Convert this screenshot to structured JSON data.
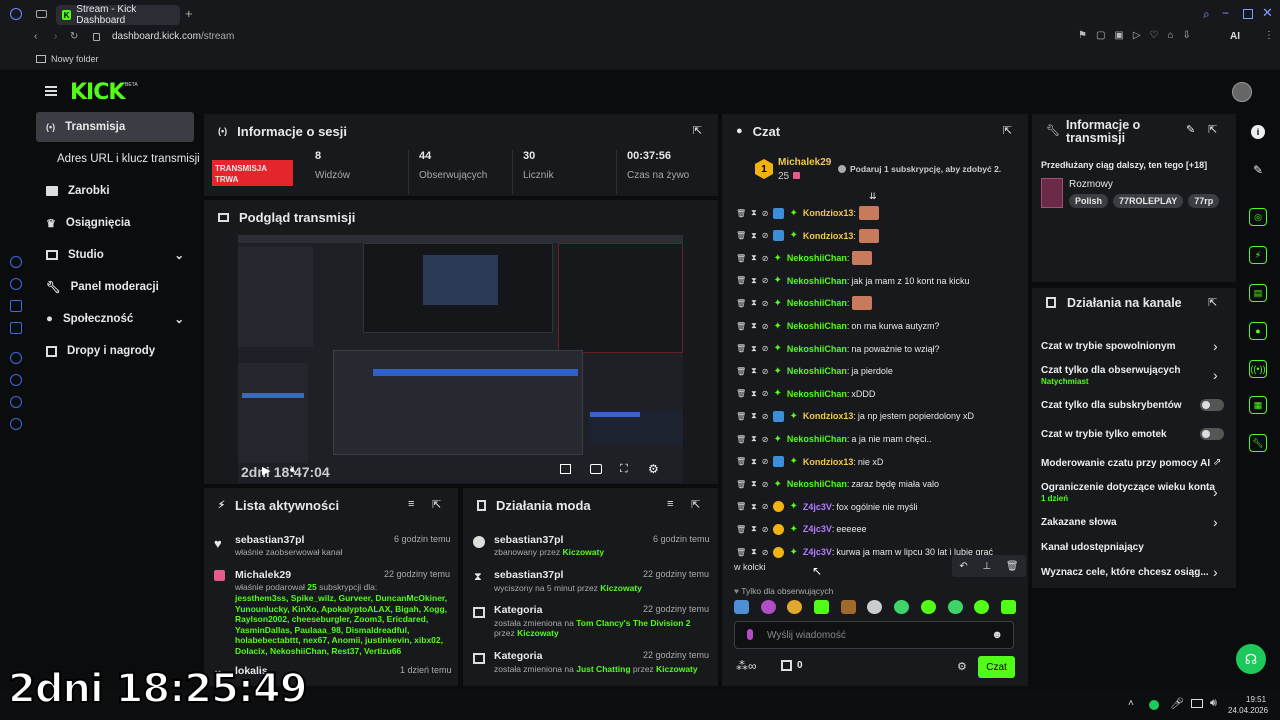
{
  "browser": {
    "tab_title": "Stream - Kick Dashboard",
    "url_domain": "dashboard.kick.com",
    "url_path": "/stream",
    "bookmark": "Nowy folder",
    "ai_label": "AI"
  },
  "brand": {
    "logo": "KICK",
    "beta": "BETA",
    "accent": "#53fc18"
  },
  "nav": [
    {
      "label": "Transmisja"
    },
    {
      "label": "Adres URL i klucz transmisji"
    },
    {
      "label": "Zarobki"
    },
    {
      "label": "Osiągnięcia"
    },
    {
      "label": "Studio"
    },
    {
      "label": "Panel moderacji"
    },
    {
      "label": "Społeczność"
    },
    {
      "label": "Dropy i nagrody"
    }
  ],
  "session": {
    "title": "Informacje o sesji",
    "badge1": "TRANSMISJA",
    "badge2": "TRWA",
    "stats": [
      {
        "value": "8",
        "label": "Widzów"
      },
      {
        "value": "44",
        "label": "Obserwujących"
      },
      {
        "value": "30",
        "label": "Licznik"
      },
      {
        "value": "00:37:56",
        "label": "Czas na żywo"
      }
    ]
  },
  "preview": {
    "title": "Podgląd transmisji",
    "overlay_time": "2dni 18:47:04"
  },
  "activity": {
    "title": "Lista aktywności",
    "items": [
      {
        "user": "sebastian37pl",
        "time": "6 godzin temu",
        "desc": "właśnie zaobserwował kanał"
      },
      {
        "user": "Michalek29",
        "time": "22 godziny temu",
        "desc_pre": "właśnie podarował ",
        "count": "25",
        "desc_post": " subskrypcji dla:",
        "gift_lines": [
          "jessthem3ss, Spike_wilz, Gurveer, DuncanMcOkiner,",
          "Yunounlucky, KinXo, ApokalyptoALAX, Bigah, Xogg,",
          "Raylson2002, cheeseburgler, Zoom3, Ericdared,",
          "YasminDallas, Paulaaa_98, Dismaldreadful,",
          "holabebectabttt, nex67, Anomii, justinkevin, xibx02,",
          "Dolacix, NekoshiiChan, Rest37, Vertizu66"
        ]
      },
      {
        "user": "lokalis",
        "time": "1 dzień temu"
      }
    ]
  },
  "modactions": {
    "title": "Działania moda",
    "items": [
      {
        "user": "sebastian37pl",
        "time": "6 godzin temu",
        "pre": "zbanowany przez ",
        "by": "Kiczowaty"
      },
      {
        "user": "sebastian37pl",
        "time": "22 godziny temu",
        "pre": "wyciszony na 5 minut przez ",
        "by": "Kiczowaty"
      },
      {
        "user": "Kategoria",
        "time": "22 godziny temu",
        "pre": "została zmieniona na ",
        "cat": "Tom Clancy's The Division 2",
        "pre2": "przez ",
        "by": "Kiczowaty"
      },
      {
        "user": "Kategoria",
        "time": "22 godziny temu",
        "pre": "została zmieniona na ",
        "cat": "Just Chatting",
        "pre2": " przez ",
        "by": "Kiczowaty"
      }
    ]
  },
  "chat": {
    "title": "Czat",
    "top_user": "Michalek29",
    "top_count": "25",
    "top_rank": "1",
    "gift_prompt": "Podaruj 1 subskrypcję, aby zdobyć 2.",
    "messages": [
      {
        "user": "Kondziox13",
        "color": "#f2c94c",
        "text": "",
        "emote": true
      },
      {
        "user": "Kondziox13",
        "color": "#f2c94c",
        "text": "",
        "emote": true
      },
      {
        "user": "NekoshiiChan",
        "color": "#53fc18",
        "text": "",
        "emote": true
      },
      {
        "user": "NekoshiiChan",
        "color": "#53fc18",
        "text": "jak ja mam z 10 kont na kicku"
      },
      {
        "user": "NekoshiiChan",
        "color": "#53fc18",
        "text": "",
        "emote": true
      },
      {
        "user": "NekoshiiChan",
        "color": "#53fc18",
        "text": "on ma kurwa autyzm?"
      },
      {
        "user": "NekoshiiChan",
        "color": "#53fc18",
        "text": "na poważnie to wziął?"
      },
      {
        "user": "NekoshiiChan",
        "color": "#53fc18",
        "text": "ja pierdole"
      },
      {
        "user": "NekoshiiChan",
        "color": "#53fc18",
        "text": "xDDD"
      },
      {
        "user": "Kondziox13",
        "color": "#f2c94c",
        "text": "ja np jestem popierdolony xD"
      },
      {
        "user": "NekoshiiChan",
        "color": "#53fc18",
        "text": "a ja nie mam chęci.."
      },
      {
        "user": "Kondziox13",
        "color": "#f2c94c",
        "text": "nie xD"
      },
      {
        "user": "NekoshiiChan",
        "color": "#53fc18",
        "text": "zaraz będę miała valo"
      },
      {
        "user": "Z4jc3V",
        "color": "#b57bff",
        "text": "fox ogólnie nie myśli"
      },
      {
        "user": "Z4jc3V",
        "color": "#b57bff",
        "text": "eeeeee"
      },
      {
        "user": "Z4jc3V",
        "color": "#b57bff",
        "text": "kurwa ja mam w lipcu 30 lat i lubię grać"
      }
    ],
    "overflow_text": "w kolcki",
    "followers_only": "Tylko dla obserwujących",
    "input_placeholder": "Wyślij wiadomość",
    "points": "0",
    "send": "Czat"
  },
  "stream_info": {
    "title": "Informacje o transmisji",
    "stream_title": "Przedłużany ciąg dalszy, ten tego [+18]",
    "category": "Rozmowy",
    "tags": [
      "Polish",
      "77ROLEPLAY",
      "77rp"
    ]
  },
  "channel_actions": {
    "title": "Działania na kanale",
    "items": [
      {
        "label": "Czat w trybie spowolnionym",
        "type": "arrow"
      },
      {
        "label": "Czat tylko dla obserwujących",
        "sub": "Natychmiast",
        "type": "arrow"
      },
      {
        "label": "Czat tylko dla subskrybentów",
        "type": "toggle"
      },
      {
        "label": "Czat w trybie tylko emotek",
        "type": "toggle"
      },
      {
        "label": "Moderowanie czatu przy pomocy AI",
        "type": "ext"
      },
      {
        "label": "Ograniczenie dotyczące wieku konta",
        "sub": "1 dzień",
        "type": "arrow"
      },
      {
        "label": "Zakazane słowa",
        "type": "arrow"
      },
      {
        "label": "Kanał udostępniający",
        "type": "none"
      },
      {
        "label": "Wyznacz cele, które chcesz osiąg...",
        "type": "arrow"
      }
    ]
  },
  "overlay_counter": "2dni 18:25:49",
  "taskbar": {
    "time": "19:51",
    "date": "24.04.2026"
  }
}
